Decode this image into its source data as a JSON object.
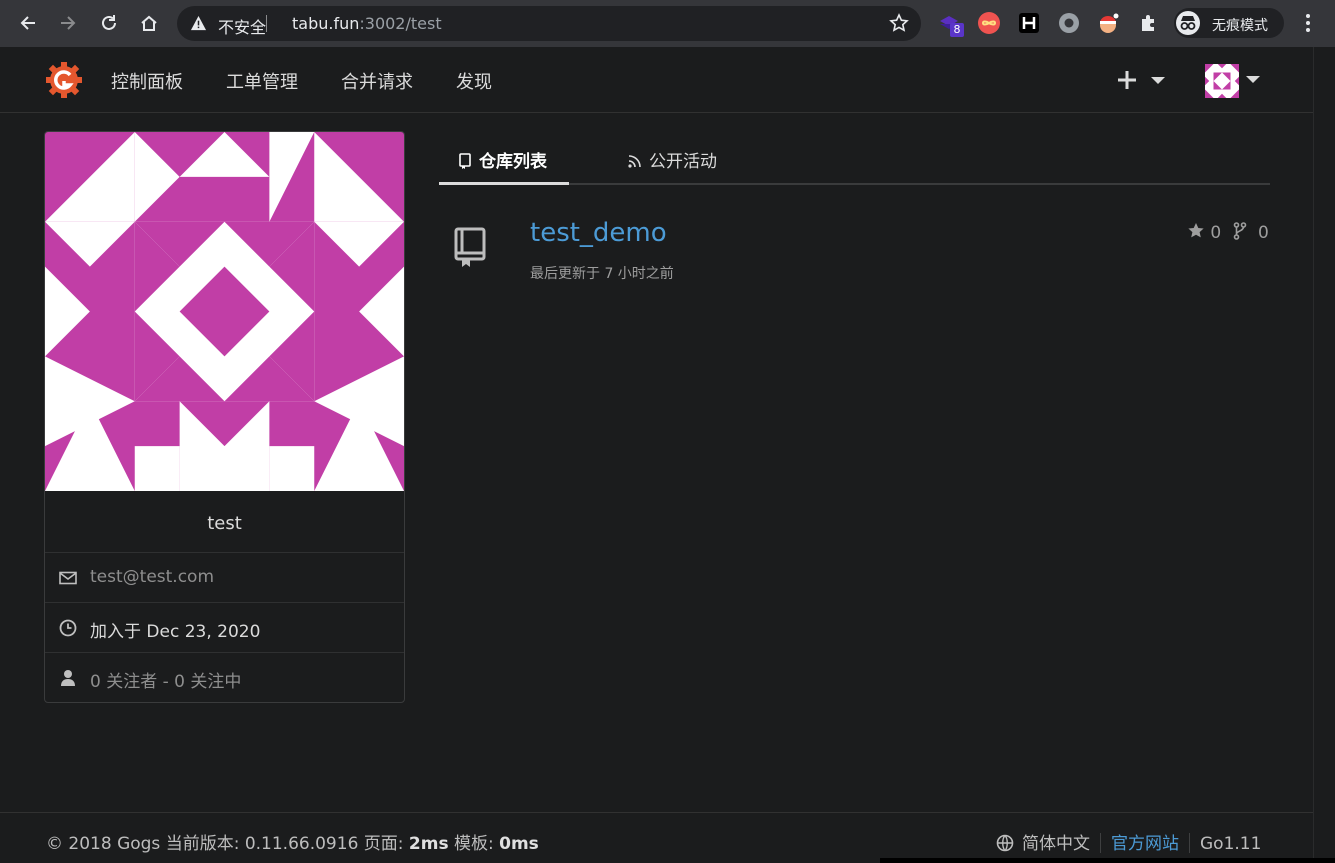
{
  "browser": {
    "security_label": "不安全",
    "url_host": "tabu.fun",
    "url_rest": ":3002/test",
    "extension_badge": "8",
    "incognito_label": "无痕模式"
  },
  "header": {
    "nav": [
      "控制面板",
      "工单管理",
      "合并请求",
      "发现"
    ]
  },
  "profile": {
    "username": "test",
    "email": "test@test.com",
    "joined": "加入于 Dec 23, 2020",
    "follow": "0 关注者 - 0 关注中"
  },
  "tabs": {
    "repos": "仓库列表",
    "activity": "公开活动"
  },
  "repo": {
    "name": "test_demo",
    "updated": "最后更新于 7 小时之前",
    "stars": "0",
    "forks": "0"
  },
  "footer": {
    "copyright": "© 2018 Gogs 当前版本: 0.11.66.0916 页面: ",
    "page_time": "2ms",
    "template_label": " 模板: ",
    "template_time": "0ms",
    "language": "简体中文",
    "official_site": "官方网站",
    "go_version": "Go1.11"
  },
  "colors": {
    "accent": "#4c9bd6",
    "avatar_magenta": "#c13ea6",
    "background": "#1b1c1d"
  }
}
